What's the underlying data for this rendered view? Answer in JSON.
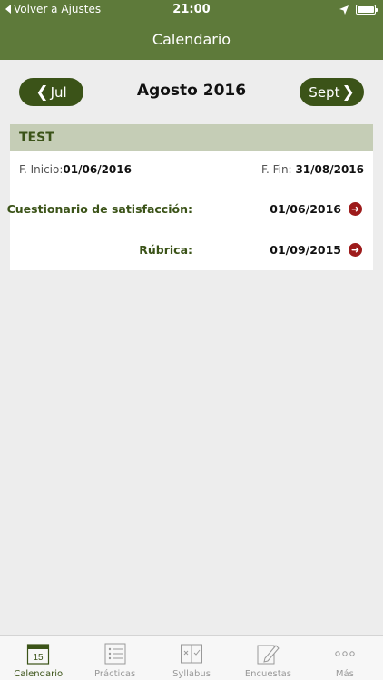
{
  "status_bar": {
    "back_label": "Volver a Ajustes",
    "time": "21:00"
  },
  "header": {
    "title": "Calendario"
  },
  "month_nav": {
    "prev_label": "Jul",
    "current": "Agosto 2016",
    "next_label": "Sept"
  },
  "course": {
    "title": "TEST",
    "start_label": "F. Inicio:",
    "start_value": "01/06/2016",
    "end_label": "F. Fin:",
    "end_value": "31/08/2016",
    "activities": [
      {
        "name": "Cuestionario de satisfacción:",
        "date": "01/06/2016"
      },
      {
        "name": "Rúbrica:",
        "date": "01/09/2015"
      }
    ]
  },
  "tabs": [
    {
      "label": "Calendario",
      "icon": "calendar-icon",
      "active": true,
      "icon_text": "15"
    },
    {
      "label": "Prácticas",
      "icon": "list-icon"
    },
    {
      "label": "Syllabus",
      "icon": "book-icon"
    },
    {
      "label": "Encuestas",
      "icon": "pencil-icon"
    },
    {
      "label": "Más",
      "icon": "more-icon"
    }
  ],
  "colors": {
    "header": "#5e7a3a",
    "accent": "#3b5318",
    "arrow": "#9d1b1b"
  }
}
